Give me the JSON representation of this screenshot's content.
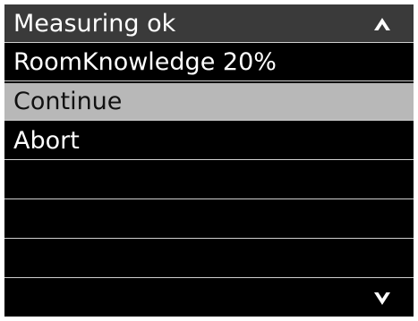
{
  "header": {
    "title": "Measuring ok",
    "scroll_up_icon": "chevron-up-icon"
  },
  "menu": {
    "items": [
      {
        "label": "RoomKnowledge 20%",
        "selected": false
      },
      {
        "label": "Continue",
        "selected": true
      },
      {
        "label": "Abort",
        "selected": false
      }
    ],
    "scroll_down_icon": "chevron-down-icon"
  },
  "colors": {
    "background": "#000000",
    "header": "#3a3a3a",
    "selected_row": "#b8b8b8",
    "text": "#ffffff",
    "selected_text": "#111111",
    "divider": "#d0d0d0"
  }
}
